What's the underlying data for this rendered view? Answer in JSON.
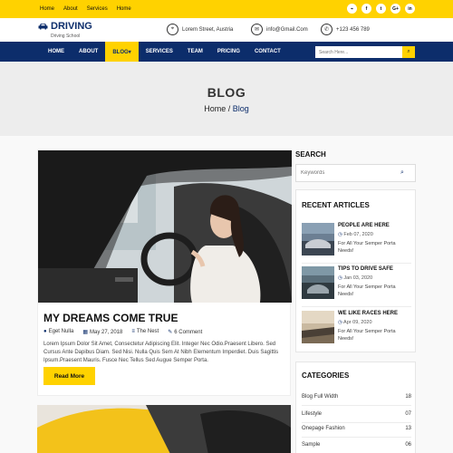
{
  "topnav": {
    "items": [
      "Home",
      "About",
      "Services",
      "Home"
    ]
  },
  "social": {
    "icons": [
      {
        "name": "rss-icon",
        "glyph": "⌁"
      },
      {
        "name": "facebook-icon",
        "glyph": "f"
      },
      {
        "name": "twitter-icon",
        "glyph": "t"
      },
      {
        "name": "google-plus-icon",
        "glyph": "G+"
      },
      {
        "name": "linkedin-icon",
        "glyph": "in"
      }
    ]
  },
  "header": {
    "logo_title": "DRIVING",
    "logo_subtitle": "Driving School",
    "location": "Lorem Street, Austria",
    "email": "info@Gmail.Com",
    "phone": "+123 456 789"
  },
  "nav": {
    "items": [
      "HOME",
      "ABOUT",
      "BLOG▾",
      "SERVICES",
      "TEAM",
      "PRICING",
      "CONTACT"
    ],
    "active_index": 2,
    "search_placeholder": "Search Here..."
  },
  "banner": {
    "title": "BLOG",
    "crumb_home": "Home",
    "crumb_sep": " / ",
    "crumb_current": "Blog"
  },
  "post": {
    "title": "MY DREAMS COME TRUE",
    "author": "Eget Nulla",
    "date": "May 27, 2018",
    "category": "The Nest",
    "comments": "6 Comment",
    "excerpt": "Lorem Ipsum Dolor Sit Amet, Consectetur Adipiscing Elit. Integer Nec Odio.Praesent Libero. Sed Cursus Ante Dapibus Diam. Sed Nisi. Nulla Quis Sem At Nibh Elementum Imperdiet. Duis Sagittis Ipsum.Praesent Mauris. Fusce Nec Tellus Sed Augue Semper Porta.",
    "read_more": "Read More"
  },
  "sidebar": {
    "search_heading": "SEARCH",
    "search_placeholder": "Keywords",
    "recent_heading": "RECENT ARTICLES",
    "recent": [
      {
        "title": "PEOPLE ARE HERE",
        "date": "Feb 07, 2020",
        "text": "For All Your Semper Porta Needs!"
      },
      {
        "title": "TIPS TO DRIVE SAFE",
        "date": "Jan 03, 2020",
        "text": "For All Your Semper Porta Needs!"
      },
      {
        "title": "WE LIKE RACES HERE",
        "date": "Apr 09, 2020",
        "text": "For All Your Semper Porta Needs!"
      }
    ],
    "categories_heading": "CATEGORIES",
    "categories": [
      {
        "name": "Blog Full Width",
        "count": "18"
      },
      {
        "name": "Lifestyle",
        "count": "07"
      },
      {
        "name": "Onepage Fashion",
        "count": "13"
      },
      {
        "name": "Sample",
        "count": "06"
      }
    ]
  },
  "colors": {
    "accent_yellow": "#ffd200",
    "navy": "#0c2d6b"
  }
}
